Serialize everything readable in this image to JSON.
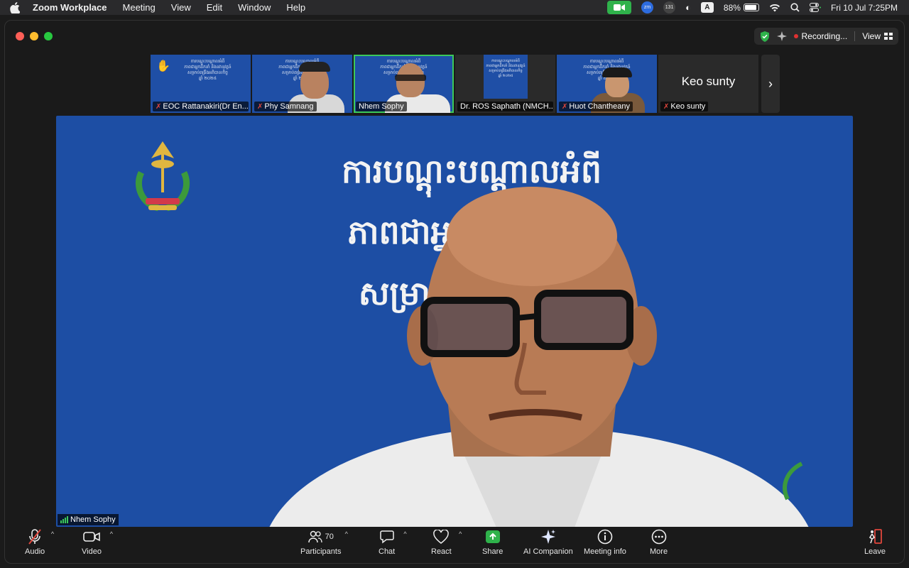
{
  "menubar": {
    "app_name": "Zoom Workplace",
    "menus": [
      "Meeting",
      "View",
      "Edit",
      "Window",
      "Help"
    ],
    "zoom_badge": "zm",
    "notif_count": "131",
    "input_source": "A",
    "battery_percent": "88%",
    "battery_level": 0.88,
    "datetime": "Fri 10 Jul  7:25PM"
  },
  "window": {
    "recording_label": "Recording...",
    "view_label": "View"
  },
  "participants_strip": [
    {
      "name": "EOC Rattanakiri(Dr En...",
      "muted": true,
      "hand_raised": true,
      "type": "slide"
    },
    {
      "name": "Phy Samnang",
      "muted": true,
      "type": "slide-face"
    },
    {
      "name": "Nhem Sophy",
      "muted": false,
      "type": "slide-face",
      "active": true
    },
    {
      "name": "Dr. ROS Saphath (NMCH...",
      "muted": false,
      "type": "dark-slide"
    },
    {
      "name": "Huot Chantheany",
      "muted": true,
      "type": "slide-face"
    },
    {
      "name": "Keo sunty",
      "muted": true,
      "type": "text",
      "display_text": "Keo sunty"
    }
  ],
  "tile_slide_text": "ការបណ្តុះបណ្តាលអំពី\nភាពជាអ្នកដឹកនាំ និងនវានុវត្តន៍\nសម្រាប់ពង្រឹងអភិបាលកិច្ច\nឆ្នាំ ២០២៥",
  "main": {
    "slide_title_lines": [
      "ការបណ្តុះបណ្តាលអំពី",
      "ភាពជាអ្នក      នវានុវត្តន៍",
      "សម្រាប់ពារ           ភិបាល"
    ],
    "speaker_name": "Nhem Sophy"
  },
  "toolbar": {
    "audio": "Audio",
    "video": "Video",
    "participants": "Participants",
    "participants_count": "70",
    "chat": "Chat",
    "react": "React",
    "share": "Share",
    "ai_companion": "AI Companion",
    "meeting_info": "Meeting info",
    "more": "More",
    "leave": "Leave"
  }
}
